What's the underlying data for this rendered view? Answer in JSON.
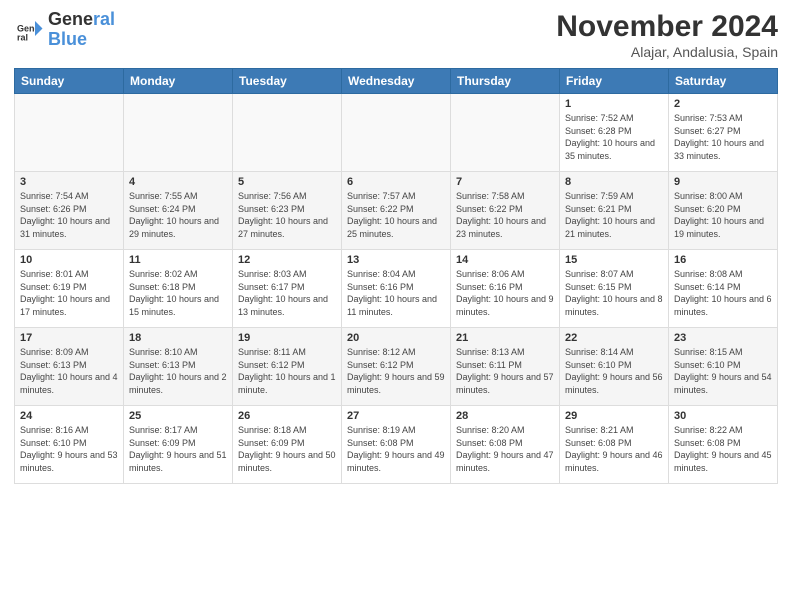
{
  "logo": {
    "line1": "General",
    "line2": "Blue"
  },
  "title": "November 2024",
  "location": "Alajar, Andalusia, Spain",
  "weekdays": [
    "Sunday",
    "Monday",
    "Tuesday",
    "Wednesday",
    "Thursday",
    "Friday",
    "Saturday"
  ],
  "weeks": [
    [
      {
        "day": "",
        "info": ""
      },
      {
        "day": "",
        "info": ""
      },
      {
        "day": "",
        "info": ""
      },
      {
        "day": "",
        "info": ""
      },
      {
        "day": "",
        "info": ""
      },
      {
        "day": "1",
        "info": "Sunrise: 7:52 AM\nSunset: 6:28 PM\nDaylight: 10 hours and 35 minutes."
      },
      {
        "day": "2",
        "info": "Sunrise: 7:53 AM\nSunset: 6:27 PM\nDaylight: 10 hours and 33 minutes."
      }
    ],
    [
      {
        "day": "3",
        "info": "Sunrise: 7:54 AM\nSunset: 6:26 PM\nDaylight: 10 hours and 31 minutes."
      },
      {
        "day": "4",
        "info": "Sunrise: 7:55 AM\nSunset: 6:24 PM\nDaylight: 10 hours and 29 minutes."
      },
      {
        "day": "5",
        "info": "Sunrise: 7:56 AM\nSunset: 6:23 PM\nDaylight: 10 hours and 27 minutes."
      },
      {
        "day": "6",
        "info": "Sunrise: 7:57 AM\nSunset: 6:22 PM\nDaylight: 10 hours and 25 minutes."
      },
      {
        "day": "7",
        "info": "Sunrise: 7:58 AM\nSunset: 6:22 PM\nDaylight: 10 hours and 23 minutes."
      },
      {
        "day": "8",
        "info": "Sunrise: 7:59 AM\nSunset: 6:21 PM\nDaylight: 10 hours and 21 minutes."
      },
      {
        "day": "9",
        "info": "Sunrise: 8:00 AM\nSunset: 6:20 PM\nDaylight: 10 hours and 19 minutes."
      }
    ],
    [
      {
        "day": "10",
        "info": "Sunrise: 8:01 AM\nSunset: 6:19 PM\nDaylight: 10 hours and 17 minutes."
      },
      {
        "day": "11",
        "info": "Sunrise: 8:02 AM\nSunset: 6:18 PM\nDaylight: 10 hours and 15 minutes."
      },
      {
        "day": "12",
        "info": "Sunrise: 8:03 AM\nSunset: 6:17 PM\nDaylight: 10 hours and 13 minutes."
      },
      {
        "day": "13",
        "info": "Sunrise: 8:04 AM\nSunset: 6:16 PM\nDaylight: 10 hours and 11 minutes."
      },
      {
        "day": "14",
        "info": "Sunrise: 8:06 AM\nSunset: 6:16 PM\nDaylight: 10 hours and 9 minutes."
      },
      {
        "day": "15",
        "info": "Sunrise: 8:07 AM\nSunset: 6:15 PM\nDaylight: 10 hours and 8 minutes."
      },
      {
        "day": "16",
        "info": "Sunrise: 8:08 AM\nSunset: 6:14 PM\nDaylight: 10 hours and 6 minutes."
      }
    ],
    [
      {
        "day": "17",
        "info": "Sunrise: 8:09 AM\nSunset: 6:13 PM\nDaylight: 10 hours and 4 minutes."
      },
      {
        "day": "18",
        "info": "Sunrise: 8:10 AM\nSunset: 6:13 PM\nDaylight: 10 hours and 2 minutes."
      },
      {
        "day": "19",
        "info": "Sunrise: 8:11 AM\nSunset: 6:12 PM\nDaylight: 10 hours and 1 minute."
      },
      {
        "day": "20",
        "info": "Sunrise: 8:12 AM\nSunset: 6:12 PM\nDaylight: 9 hours and 59 minutes."
      },
      {
        "day": "21",
        "info": "Sunrise: 8:13 AM\nSunset: 6:11 PM\nDaylight: 9 hours and 57 minutes."
      },
      {
        "day": "22",
        "info": "Sunrise: 8:14 AM\nSunset: 6:10 PM\nDaylight: 9 hours and 56 minutes."
      },
      {
        "day": "23",
        "info": "Sunrise: 8:15 AM\nSunset: 6:10 PM\nDaylight: 9 hours and 54 minutes."
      }
    ],
    [
      {
        "day": "24",
        "info": "Sunrise: 8:16 AM\nSunset: 6:10 PM\nDaylight: 9 hours and 53 minutes."
      },
      {
        "day": "25",
        "info": "Sunrise: 8:17 AM\nSunset: 6:09 PM\nDaylight: 9 hours and 51 minutes."
      },
      {
        "day": "26",
        "info": "Sunrise: 8:18 AM\nSunset: 6:09 PM\nDaylight: 9 hours and 50 minutes."
      },
      {
        "day": "27",
        "info": "Sunrise: 8:19 AM\nSunset: 6:08 PM\nDaylight: 9 hours and 49 minutes."
      },
      {
        "day": "28",
        "info": "Sunrise: 8:20 AM\nSunset: 6:08 PM\nDaylight: 9 hours and 47 minutes."
      },
      {
        "day": "29",
        "info": "Sunrise: 8:21 AM\nSunset: 6:08 PM\nDaylight: 9 hours and 46 minutes."
      },
      {
        "day": "30",
        "info": "Sunrise: 8:22 AM\nSunset: 6:08 PM\nDaylight: 9 hours and 45 minutes."
      }
    ]
  ]
}
